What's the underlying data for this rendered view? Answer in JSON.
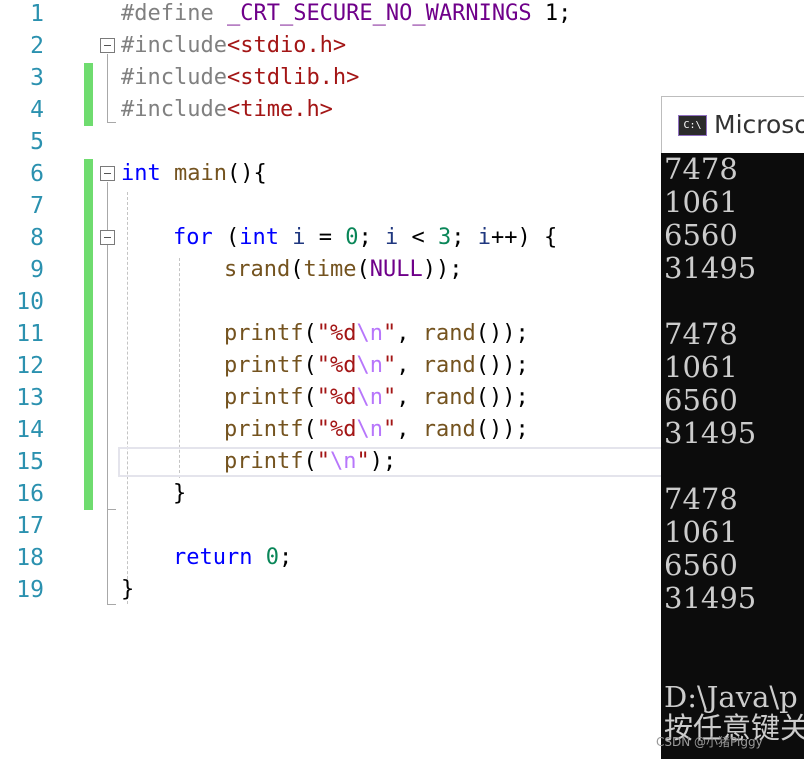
{
  "line_numbers": [
    "1",
    "2",
    "3",
    "4",
    "5",
    "6",
    "7",
    "8",
    "9",
    "10",
    "11",
    "12",
    "13",
    "14",
    "15",
    "16",
    "17",
    "18",
    "19"
  ],
  "code": {
    "l1": {
      "a": "#define ",
      "b": "_CRT_SECURE_NO_WARNINGS",
      "c": " 1;"
    },
    "l2": {
      "a": "#include",
      "b": "<stdio.h>"
    },
    "l3": {
      "a": "#include",
      "b": "<stdlib.h>"
    },
    "l4": {
      "a": "#include",
      "b": "<time.h>"
    },
    "l6": {
      "a": "int",
      "b": " main",
      "c": "(){"
    },
    "l8": {
      "a": "for",
      "b": " (",
      "c": "int",
      "d": " i",
      "e": " = ",
      "f": "0",
      "g": "; ",
      "h": "i",
      "i": " < ",
      "j": "3",
      "k": "; ",
      "l": "i",
      "m": "++) {"
    },
    "l9": {
      "a": "srand",
      "b": "(",
      "c": "time",
      "d": "(",
      "e": "NULL",
      "f": "));"
    },
    "printf_line": {
      "fn": "printf",
      "open": "(",
      "q1": "\"%d",
      "esc": "\\n",
      "q2": "\"",
      "sep": ", ",
      "rand": "rand",
      "end": "());"
    },
    "l15": {
      "fn": "printf",
      "open": "(",
      "q1": "\"",
      "esc": "\\n",
      "q2": "\"",
      "end": ");"
    },
    "l16": {
      "a": "}"
    },
    "l18": {
      "a": "return",
      "b": " ",
      "c": "0",
      "d": ";"
    },
    "l19": {
      "a": "}"
    }
  },
  "console": {
    "title": "Microso",
    "icon_label": "C:\\",
    "output": [
      "7478",
      "1061",
      "6560",
      "31495",
      "",
      "7478",
      "1061",
      "6560",
      "31495",
      "",
      "7478",
      "1061",
      "6560",
      "31495"
    ],
    "path_line": "D:\\Java\\p",
    "press_key_line": "按任意键关"
  },
  "watermark": "CSDN @小猪Piggy"
}
